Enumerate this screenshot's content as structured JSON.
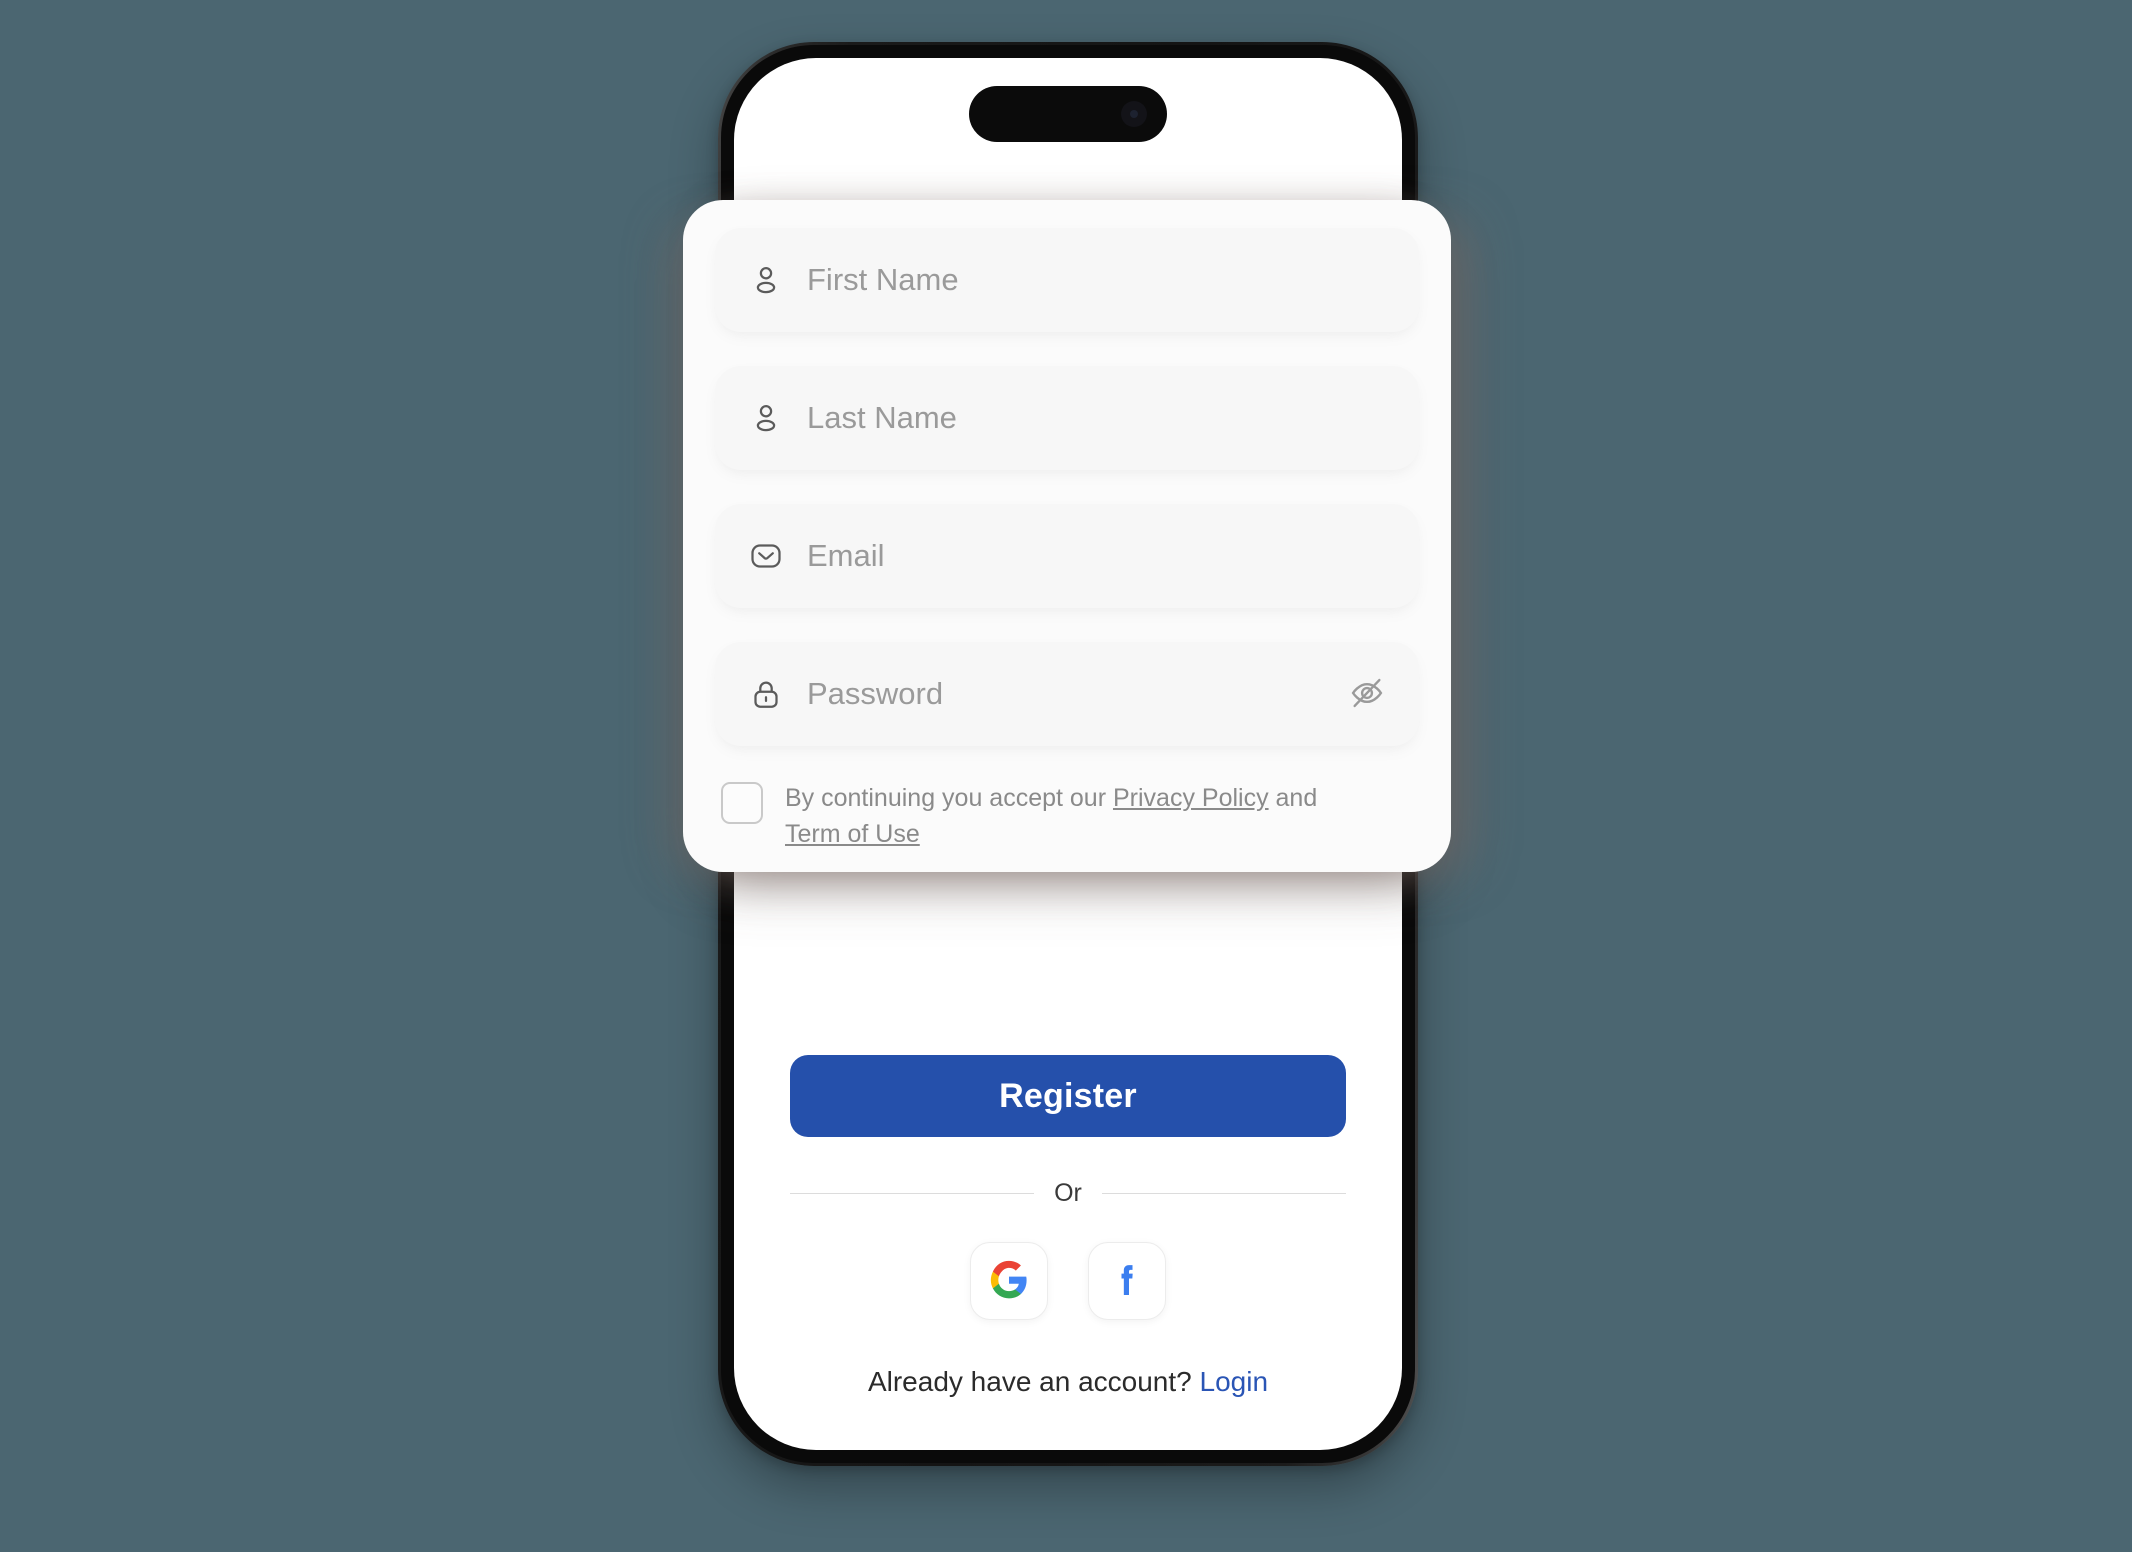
{
  "background_color": "#4b6671",
  "device": {
    "name": "smartphone-mockup",
    "frame_color": "#141414",
    "screen_background": "#ffffff"
  },
  "form_card": {
    "background": "#fbfbfb",
    "fields": [
      {
        "name": "first-name",
        "icon": "user-icon",
        "placeholder": "First Name",
        "value": ""
      },
      {
        "name": "last-name",
        "icon": "user-icon",
        "placeholder": "Last Name",
        "value": ""
      },
      {
        "name": "email",
        "icon": "envelope-icon",
        "placeholder": "Email",
        "value": ""
      },
      {
        "name": "password",
        "icon": "lock-icon",
        "placeholder": "Password",
        "value": "",
        "trailing_icon": "eye-off-icon"
      }
    ],
    "terms": {
      "checked": false,
      "prefix": "By continuing you accept our ",
      "privacy_link": "Privacy Policy",
      "conjunction": " and ",
      "terms_link": "Term of Use"
    }
  },
  "actions": {
    "register_label": "Register",
    "register_color": "#2550ab",
    "divider_label": "Or",
    "social": [
      {
        "name": "google",
        "icon": "google-g-icon"
      },
      {
        "name": "facebook",
        "icon": "facebook-f-icon"
      }
    ],
    "footer_text": "Already have an account? ",
    "footer_link": "Login",
    "footer_link_color": "#2a55b5"
  }
}
